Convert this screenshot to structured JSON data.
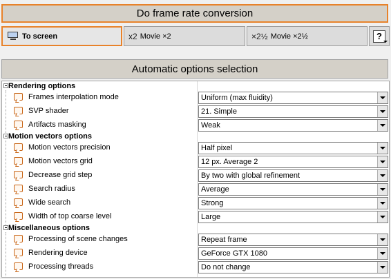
{
  "convert_button": "Do frame rate conversion",
  "modes": [
    {
      "label": "To screen",
      "icon": "monitor-icon",
      "icon_text": ""
    },
    {
      "label": "Movie ×2",
      "icon": "x2-icon",
      "icon_text": "x2"
    },
    {
      "label": "Movie ×2½",
      "icon": "x2-half-icon",
      "icon_text": "×2½"
    }
  ],
  "help_button": "?",
  "auto_button": "Automatic options selection",
  "sections": [
    {
      "title": "Rendering options",
      "options": [
        {
          "label": "Frames interpolation mode",
          "value": "Uniform (max fluidity)"
        },
        {
          "label": "SVP shader",
          "value": "21. Simple"
        },
        {
          "label": "Artifacts masking",
          "value": "Weak"
        }
      ]
    },
    {
      "title": "Motion vectors options",
      "options": [
        {
          "label": "Motion vectors precision",
          "value": "Half pixel"
        },
        {
          "label": "Motion vectors grid",
          "value": "12 px. Average 2"
        },
        {
          "label": "Decrease grid step",
          "value": "By two with global refinement"
        },
        {
          "label": "Search radius",
          "value": "Average"
        },
        {
          "label": "Wide search",
          "value": "Strong"
        },
        {
          "label": "Width of top coarse level",
          "value": "Large"
        }
      ]
    },
    {
      "title": "Miscellaneous options",
      "options": [
        {
          "label": "Processing of scene changes",
          "value": "Repeat frame"
        },
        {
          "label": "Rendering device",
          "value": "GeForce GTX 1080"
        },
        {
          "label": "Processing threads",
          "value": "Do not change"
        }
      ]
    }
  ]
}
